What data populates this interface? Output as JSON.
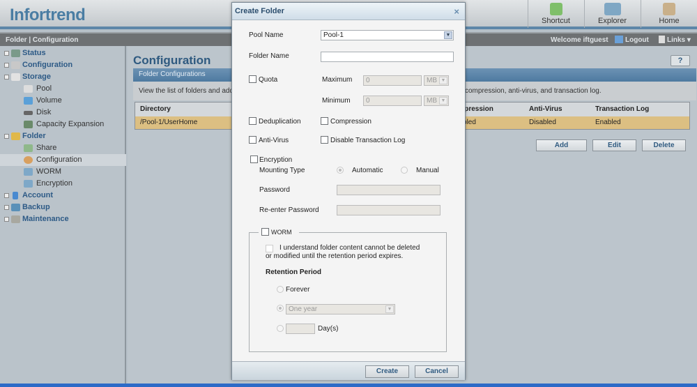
{
  "header": {
    "logo": "Infortrend",
    "nav": [
      {
        "label": "Shortcut",
        "icon": "shortcut-icon"
      },
      {
        "label": "Explorer",
        "icon": "explorer-icon"
      },
      {
        "label": "Home",
        "icon": "home-icon"
      }
    ]
  },
  "subbar": {
    "breadcrumb": "Folder | Configuration",
    "welcome": "Welcome iftguest",
    "logout": "Logout",
    "links": "Links ▾"
  },
  "sidebar": {
    "items": [
      {
        "label": "Status",
        "level": 0,
        "expander": "+"
      },
      {
        "label": "Configuration",
        "level": 0,
        "expander": "+"
      },
      {
        "label": "Storage",
        "level": 0,
        "expander": "−"
      },
      {
        "label": "Pool",
        "level": 1
      },
      {
        "label": "Volume",
        "level": 1
      },
      {
        "label": "Disk",
        "level": 1
      },
      {
        "label": "Capacity Expansion",
        "level": 1
      },
      {
        "label": "Folder",
        "level": 0,
        "expander": "−"
      },
      {
        "label": "Share",
        "level": 1
      },
      {
        "label": "Configuration",
        "level": 1,
        "selected": true
      },
      {
        "label": "WORM",
        "level": 1
      },
      {
        "label": "Encryption",
        "level": 1
      },
      {
        "label": "Account",
        "level": 0,
        "expander": "+"
      },
      {
        "label": "Backup",
        "level": 0,
        "expander": "+"
      },
      {
        "label": "Maintenance",
        "level": 0,
        "expander": "+"
      }
    ]
  },
  "main": {
    "title": "Configuration",
    "help": "?",
    "panel_title": "Folder Configurations",
    "description_start": "View the list of folders and add",
    "description_end": "compression, anti-virus, and transaction log.",
    "columns": [
      "Directory",
      "Compression",
      "Anti-Virus",
      "Transaction Log"
    ],
    "rows": [
      {
        "directory": "/Pool-1/UserHome",
        "compression": "Disabled",
        "antivirus": "Disabled",
        "transaction_log": "Enabled"
      }
    ],
    "buttons": {
      "add": "Add",
      "edit": "Edit",
      "delete": "Delete"
    }
  },
  "dialog": {
    "title": "Create Folder",
    "close": "×",
    "pool_name_label": "Pool Name",
    "pool_name_value": "Pool-1",
    "folder_name_label": "Folder Name",
    "folder_name_value": "",
    "quota_label": "Quota",
    "maximum_label": "Maximum",
    "maximum_value": "0",
    "maximum_unit": "MB",
    "minimum_label": "Minimum",
    "minimum_value": "0",
    "minimum_unit": "MB",
    "dedup_label": "Deduplication",
    "compression_label": "Compression",
    "antivirus_label": "Anti-Virus",
    "disable_tlog_label": "Disable Transaction Log",
    "encryption_label": "Encryption",
    "mounting_type_label": "Mounting Type",
    "automatic_label": "Automatic",
    "manual_label": "Manual",
    "password_label": "Password",
    "reenter_label": "Re-enter Password",
    "worm_label": "WORM",
    "worm_ack_line1": "I understand folder content cannot be deleted",
    "worm_ack_line2": "or modified until the retention period expires.",
    "retention_label": "Retention Period",
    "forever_label": "Forever",
    "period_value": "One year",
    "days_label": "Day(s)",
    "create": "Create",
    "cancel": "Cancel"
  }
}
